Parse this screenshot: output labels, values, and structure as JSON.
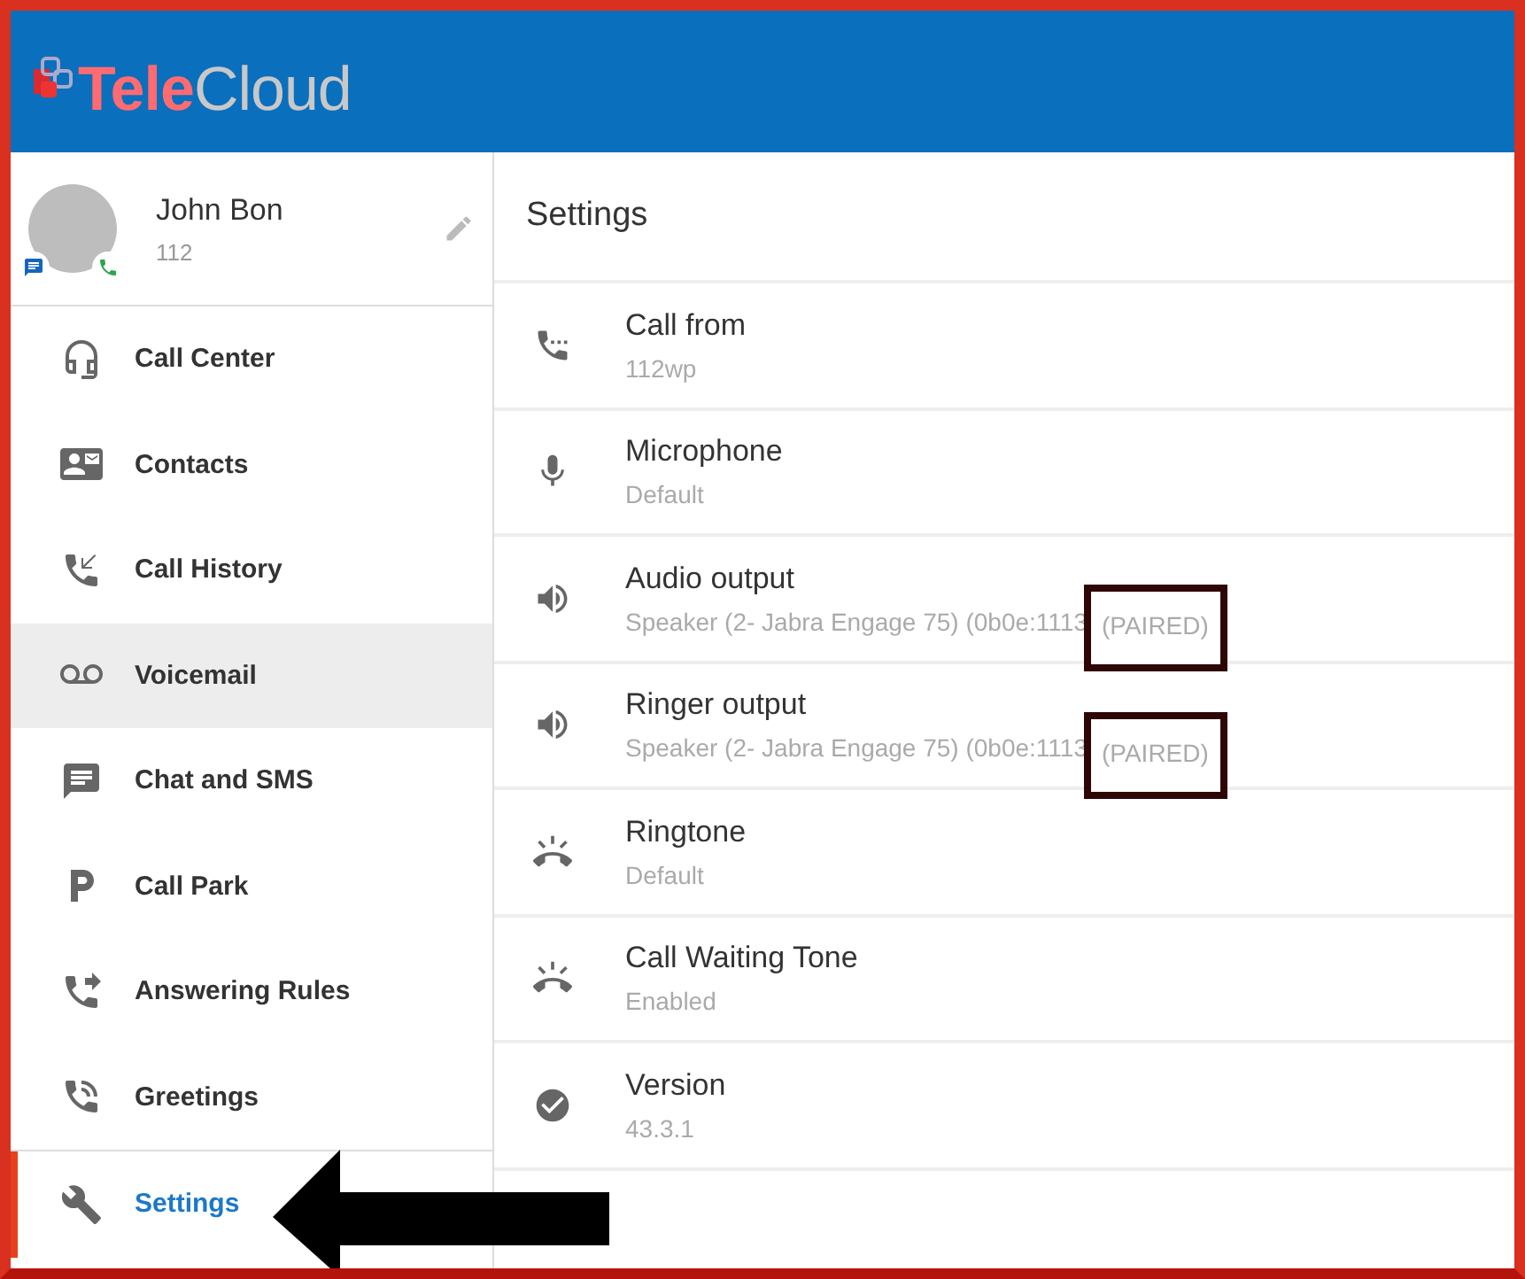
{
  "header": {
    "logo": {
      "accent": "Tele",
      "rest": "Cloud"
    }
  },
  "profile": {
    "name": "John Bon",
    "extension": "112"
  },
  "sidebar": {
    "items": [
      {
        "label": "Call Center",
        "selected": false,
        "highlighted": false
      },
      {
        "label": "Contacts",
        "selected": false,
        "highlighted": false
      },
      {
        "label": "Call History",
        "selected": false,
        "highlighted": false
      },
      {
        "label": "Voicemail",
        "selected": false,
        "highlighted": true
      },
      {
        "label": "Chat and SMS",
        "selected": false,
        "highlighted": false
      },
      {
        "label": "Call Park",
        "selected": false,
        "highlighted": false
      },
      {
        "label": "Answering Rules",
        "selected": false,
        "highlighted": false
      },
      {
        "label": "Greetings",
        "selected": false,
        "highlighted": false
      },
      {
        "label": "Settings",
        "selected": true,
        "highlighted": false
      }
    ]
  },
  "settings": {
    "title": "Settings",
    "rows": [
      {
        "label": "Call from",
        "value": "112wp"
      },
      {
        "label": "Microphone",
        "value": "Default"
      },
      {
        "label": "Audio output",
        "value": "Speaker (2- Jabra Engage 75) (0b0e:1113",
        "tag": "(PAIRED)",
        "tag_boxed": true
      },
      {
        "label": "Ringer output",
        "value": "Speaker (2- Jabra Engage 75) (0b0e:1113",
        "tag": "(PAIRED)",
        "tag_boxed": true
      },
      {
        "label": "Ringtone",
        "value": "Default"
      },
      {
        "label": "Call Waiting Tone",
        "value": "Enabled"
      },
      {
        "label": "Version",
        "value": "43.3.1"
      }
    ]
  },
  "annotations": {
    "arrow_to_selected": true
  }
}
